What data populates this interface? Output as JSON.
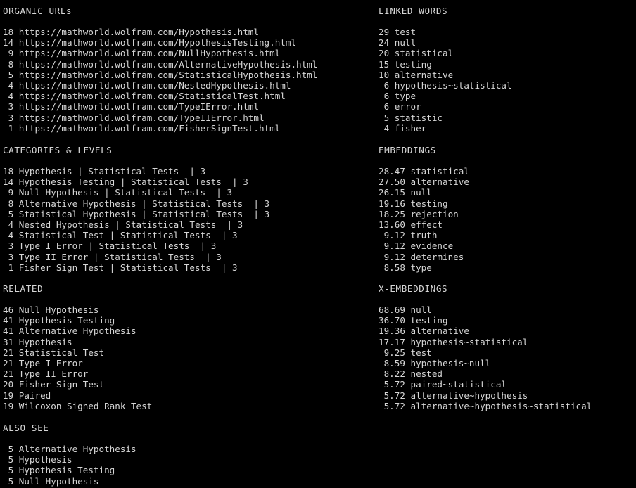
{
  "theme": {
    "background": "#000000",
    "text": "#d6d6d6"
  },
  "sections": {
    "organic_urls": {
      "title": "ORGANIC URLs",
      "entries": [
        {
          "count": "18",
          "label": "https://mathworld.wolfram.com/Hypothesis.html"
        },
        {
          "count": "14",
          "label": "https://mathworld.wolfram.com/HypothesisTesting.html"
        },
        {
          "count": "9",
          "label": "https://mathworld.wolfram.com/NullHypothesis.html"
        },
        {
          "count": "8",
          "label": "https://mathworld.wolfram.com/AlternativeHypothesis.html"
        },
        {
          "count": "5",
          "label": "https://mathworld.wolfram.com/StatisticalHypothesis.html"
        },
        {
          "count": "4",
          "label": "https://mathworld.wolfram.com/NestedHypothesis.html"
        },
        {
          "count": "4",
          "label": "https://mathworld.wolfram.com/StatisticalTest.html"
        },
        {
          "count": "3",
          "label": "https://mathworld.wolfram.com/TypeIError.html"
        },
        {
          "count": "3",
          "label": "https://mathworld.wolfram.com/TypeIIError.html"
        },
        {
          "count": "1",
          "label": "https://mathworld.wolfram.com/FisherSignTest.html"
        }
      ]
    },
    "categories_levels": {
      "title": "CATEGORIES & LEVELS",
      "entries": [
        {
          "count": "18",
          "label": "Hypothesis | Statistical Tests  | 3"
        },
        {
          "count": "14",
          "label": "Hypothesis Testing | Statistical Tests  | 3"
        },
        {
          "count": "9",
          "label": "Null Hypothesis | Statistical Tests  | 3"
        },
        {
          "count": "8",
          "label": "Alternative Hypothesis | Statistical Tests  | 3"
        },
        {
          "count": "5",
          "label": "Statistical Hypothesis | Statistical Tests  | 3"
        },
        {
          "count": "4",
          "label": "Nested Hypothesis | Statistical Tests  | 3"
        },
        {
          "count": "4",
          "label": "Statistical Test | Statistical Tests  | 3"
        },
        {
          "count": "3",
          "label": "Type I Error | Statistical Tests  | 3"
        },
        {
          "count": "3",
          "label": "Type II Error | Statistical Tests  | 3"
        },
        {
          "count": "1",
          "label": "Fisher Sign Test | Statistical Tests  | 3"
        }
      ]
    },
    "related": {
      "title": "RELATED",
      "entries": [
        {
          "count": "46",
          "label": "Null Hypothesis"
        },
        {
          "count": "41",
          "label": "Hypothesis Testing"
        },
        {
          "count": "41",
          "label": "Alternative Hypothesis"
        },
        {
          "count": "31",
          "label": "Hypothesis"
        },
        {
          "count": "21",
          "label": "Statistical Test"
        },
        {
          "count": "21",
          "label": "Type I Error"
        },
        {
          "count": "21",
          "label": "Type II Error"
        },
        {
          "count": "20",
          "label": "Fisher Sign Test"
        },
        {
          "count": "19",
          "label": "Paired"
        },
        {
          "count": "19",
          "label": "Wilcoxon Signed Rank Test"
        }
      ]
    },
    "also_see": {
      "title": "ALSO SEE",
      "entries": [
        {
          "count": "5",
          "label": "Alternative Hypothesis"
        },
        {
          "count": "5",
          "label": "Hypothesis"
        },
        {
          "count": "5",
          "label": "Hypothesis Testing"
        },
        {
          "count": "5",
          "label": "Null Hypothesis"
        }
      ]
    },
    "linked_words": {
      "title": "LINKED WORDS",
      "entries": [
        {
          "count": "29",
          "label": "test"
        },
        {
          "count": "24",
          "label": "null"
        },
        {
          "count": "20",
          "label": "statistical"
        },
        {
          "count": "15",
          "label": "testing"
        },
        {
          "count": "10",
          "label": "alternative"
        },
        {
          "count": "6",
          "label": "hypothesis~statistical"
        },
        {
          "count": "6",
          "label": "type"
        },
        {
          "count": "6",
          "label": "error"
        },
        {
          "count": "5",
          "label": "statistic"
        },
        {
          "count": "4",
          "label": "fisher"
        }
      ]
    },
    "embeddings": {
      "title": "EMBEDDINGS",
      "entries": [
        {
          "count": "28.47",
          "label": "statistical"
        },
        {
          "count": "27.50",
          "label": "alternative"
        },
        {
          "count": "26.15",
          "label": "null"
        },
        {
          "count": "19.16",
          "label": "testing"
        },
        {
          "count": "18.25",
          "label": "rejection"
        },
        {
          "count": "13.60",
          "label": "effect"
        },
        {
          "count": "9.12",
          "label": "truth"
        },
        {
          "count": "9.12",
          "label": "evidence"
        },
        {
          "count": "9.12",
          "label": "determines"
        },
        {
          "count": "8.58",
          "label": "type"
        }
      ]
    },
    "x_embeddings": {
      "title": "X-EMBEDDINGS",
      "entries": [
        {
          "count": "68.69",
          "label": "null"
        },
        {
          "count": "36.70",
          "label": "testing"
        },
        {
          "count": "19.36",
          "label": "alternative"
        },
        {
          "count": "17.17",
          "label": "hypothesis~statistical"
        },
        {
          "count": "9.25",
          "label": "test"
        },
        {
          "count": "8.59",
          "label": "hypothesis~null"
        },
        {
          "count": "8.22",
          "label": "nested"
        },
        {
          "count": "5.72",
          "label": "paired~statistical"
        },
        {
          "count": "5.72",
          "label": "alternative~hypothesis"
        },
        {
          "count": "5.72",
          "label": "alternative~hypothesis~statistical"
        }
      ]
    }
  }
}
